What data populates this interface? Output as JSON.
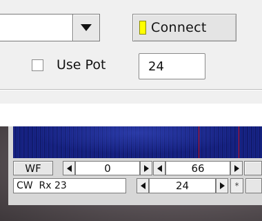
{
  "panel": {
    "connect_label": "Connect",
    "connect_led_color": "#ffff00",
    "use_pot_label": "Use Pot",
    "use_pot_checked": false,
    "pot_value": "24",
    "combo_value": ""
  },
  "controls": {
    "wf_label": "WF",
    "left_value": "0",
    "right_value": "66",
    "mode_rx_label": "CW  Rx 23",
    "rx_value": "24",
    "star_label": "*"
  },
  "icons": {
    "dropdown": "chevron-down-icon",
    "arrow_left": "arrow-left-icon",
    "arrow_right": "arrow-right-icon"
  },
  "colors": {
    "waterfall": "#121c74",
    "marker": "#cc1020"
  }
}
